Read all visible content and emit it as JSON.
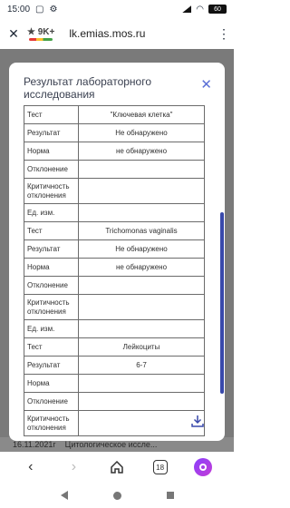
{
  "statusbar": {
    "time": "15:00",
    "left_icons": [
      "sim-card-icon",
      "settings-icon"
    ],
    "right_icons": [
      "signal-icon",
      "wifi-icon"
    ],
    "battery": "60"
  },
  "browser": {
    "close_glyph": "✕",
    "rating_badge": "★ 9K+",
    "url": "lk.emias.mos.ru",
    "menu_glyph": "⋮"
  },
  "modal": {
    "title": "Результат лабораторного исследования",
    "close_glyph": "✕",
    "rows": [
      {
        "key": "Тест",
        "value": "\"Ключевая клетка\""
      },
      {
        "key": "Результат",
        "value": "Не обнаружено"
      },
      {
        "key": "Норма",
        "value": "не обнаружено"
      },
      {
        "key": "Отклонение",
        "value": ""
      },
      {
        "key": "Критичность отклонения",
        "value": ""
      },
      {
        "key": "Ед. изм.",
        "value": ""
      },
      {
        "key": "Тест",
        "value": "Trichomonas vaginalis"
      },
      {
        "key": "Результат",
        "value": "Не обнаружено"
      },
      {
        "key": "Норма",
        "value": "не обнаружено"
      },
      {
        "key": "Отклонение",
        "value": ""
      },
      {
        "key": "Критичность отклонения",
        "value": ""
      },
      {
        "key": "Ед. изм.",
        "value": ""
      },
      {
        "key": "Тест",
        "value": "Лейкоциты"
      },
      {
        "key": "Результат",
        "value": "6-7"
      },
      {
        "key": "Норма",
        "value": ""
      },
      {
        "key": "Отклонение",
        "value": ""
      },
      {
        "key": "Критичность отклонения",
        "value": ""
      }
    ]
  },
  "background_row": {
    "date": "16.11.2021г",
    "label": "Цитологическое иссле..."
  },
  "navbar": {
    "back_glyph": "‹",
    "forward_glyph": "›",
    "home_icon": "home-icon",
    "tabs_count": "18"
  },
  "colors": {
    "accent": "#5b6fd6",
    "scrollbar": "#3949ab",
    "alice": "#8a3ffc"
  }
}
